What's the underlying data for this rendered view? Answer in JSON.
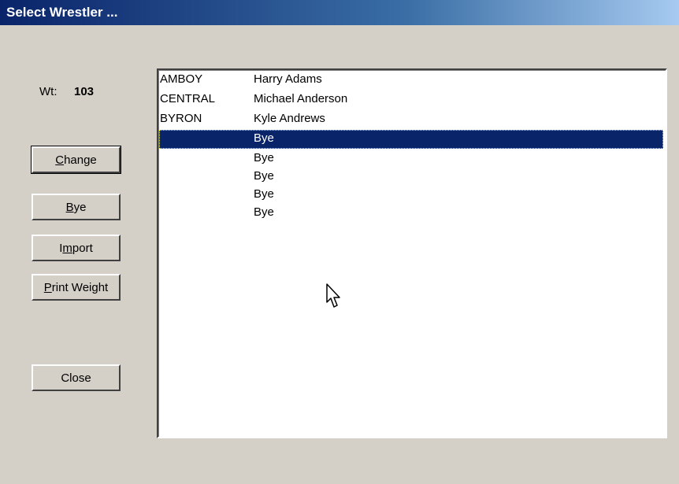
{
  "window": {
    "title": "Select Wrestler ..."
  },
  "weight": {
    "label": "Wt:",
    "value": "103"
  },
  "buttons": {
    "change": {
      "accel": "C",
      "rest": "hange"
    },
    "bye": {
      "accel": "B",
      "rest": "ye"
    },
    "import": {
      "pre": "I",
      "accel": "m",
      "rest": "port"
    },
    "print_weight": {
      "accel": "P",
      "rest": "rint Weight"
    },
    "close": {
      "label": "Close"
    }
  },
  "wrestlers": [
    {
      "team": "AMBOY",
      "name": "Harry Adams",
      "selected": false
    },
    {
      "team": "CENTRAL",
      "name": "Michael Anderson",
      "selected": false
    },
    {
      "team": "BYRON",
      "name": "Kyle Andrews",
      "selected": false
    },
    {
      "team": "",
      "name": "Bye",
      "selected": true
    },
    {
      "team": "",
      "name": "Bye",
      "selected": false
    },
    {
      "team": "",
      "name": "Bye",
      "selected": false
    },
    {
      "team": "",
      "name": "Bye",
      "selected": false
    },
    {
      "team": "",
      "name": "Bye",
      "selected": false
    }
  ],
  "colors": {
    "titlebar": "#0a246a",
    "selection": "#0a246a",
    "dialog_face": "#d4d0c8"
  },
  "icons": {
    "cursor": "arrow-cursor-icon"
  }
}
